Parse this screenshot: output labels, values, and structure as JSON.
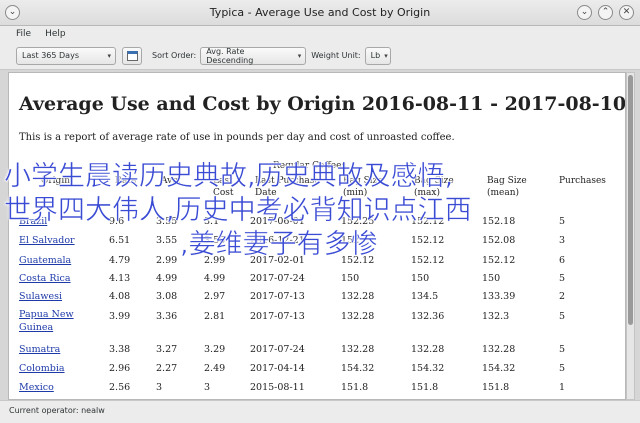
{
  "window": {
    "title": "Typica - Average Use and Cost by Origin",
    "close_glyph": "✕",
    "minimize_glyph": "⌄",
    "maximize_glyph": "⌃"
  },
  "menu": [
    "File",
    "Help"
  ],
  "toolbar": {
    "date_range": "Last 365 Days",
    "sort_label": "Sort Order:",
    "sort_value": "Avg. Rate Descending",
    "weight_label": "Weight Unit:",
    "weight_value": "Lb"
  },
  "report": {
    "title": "Average Use and Cost by Origin 2016-08-11 - 2017-08-10",
    "description": "This is a report of average rate of use in pounds per day and cost of unroasted coffee.",
    "group": "Regular Coffees",
    "headers": [
      {
        "l1": "",
        "l2": "Origin"
      },
      {
        "l1": "Rate",
        "l2": ""
      },
      {
        "l1": "Avg.",
        "l2": ""
      },
      {
        "l1": "Last",
        "l2": "Cost"
      },
      {
        "l1": "Last Purchase",
        "l2": "Date"
      },
      {
        "l1": "Bag Size",
        "l2": "(min)"
      },
      {
        "l1": "Bag Size",
        "l2": "(max)"
      },
      {
        "l1": "Bag Size",
        "l2": "(mean)"
      },
      {
        "l1": "Purchases",
        "l2": ""
      }
    ],
    "rows": [
      {
        "origin": "Brazil",
        "rate": "9.6",
        "avg": "3.55",
        "last": "3.1",
        "date": "2017-06-01",
        "min": "152.25",
        "max": "152.12",
        "mean": "152.18",
        "purchases": "5"
      },
      {
        "origin": "El Salvador",
        "rate": "6.51",
        "avg": "3.55",
        "last": "3.55",
        "date": "2016-12-21",
        "min": "152",
        "max": "152.12",
        "mean": "152.08",
        "purchases": "3"
      },
      {
        "origin": "Guatemala",
        "rate": "4.79",
        "avg": "2.99",
        "last": "2.99",
        "date": "2017-02-01",
        "min": "152.12",
        "max": "152.12",
        "mean": "152.12",
        "purchases": "6"
      },
      {
        "origin": "Costa Rica",
        "rate": "4.13",
        "avg": "4.99",
        "last": "4.99",
        "date": "2017-07-24",
        "min": "150",
        "max": "150",
        "mean": "150",
        "purchases": "5"
      },
      {
        "origin": "Sulawesi",
        "rate": "4.08",
        "avg": "3.08",
        "last": "2.97",
        "date": "2017-07-13",
        "min": "132.28",
        "max": "134.5",
        "mean": "133.39",
        "purchases": "2"
      },
      {
        "origin": "Papua New Guinea",
        "rate": "3.99",
        "avg": "3.36",
        "last": "2.81",
        "date": "2017-07-13",
        "min": "132.28",
        "max": "132.36",
        "mean": "132.3",
        "purchases": "5"
      },
      {
        "origin": "Sumatra",
        "rate": "3.38",
        "avg": "3.27",
        "last": "3.29",
        "date": "2017-07-24",
        "min": "132.28",
        "max": "132.28",
        "mean": "132.28",
        "purchases": "5"
      },
      {
        "origin": "Colombia",
        "rate": "2.96",
        "avg": "2.27",
        "last": "2.49",
        "date": "2017-04-14",
        "min": "154.32",
        "max": "154.32",
        "mean": "154.32",
        "purchases": "5"
      },
      {
        "origin": "Mexico",
        "rate": "2.56",
        "avg": "3",
        "last": "3",
        "date": "2015-08-11",
        "min": "151.8",
        "max": "151.8",
        "mean": "151.8",
        "purchases": "1"
      }
    ]
  },
  "status": "Current operator: nealw",
  "overlay": [
    "小学生晨读历史典故,历史典故及感悟,",
    "世界四大伟人,历史中考必背知识点江西",
    ",姜维妻子有多惨"
  ]
}
